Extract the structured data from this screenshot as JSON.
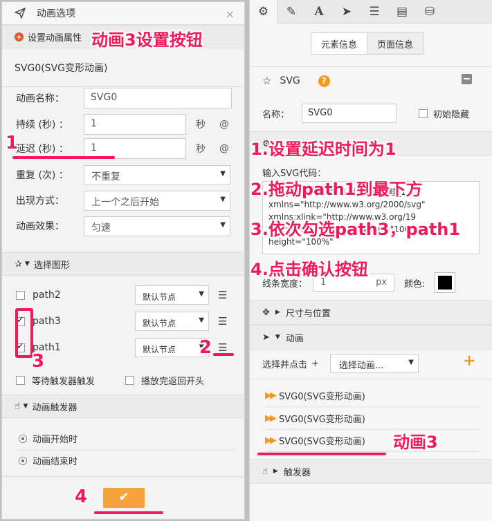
{
  "dialog": {
    "title": "动画选项",
    "close": "×",
    "section1": "设置动画属性",
    "svg_name": "SVG0(SVG变形动画)",
    "fields": {
      "name_label": "动画名称：",
      "name_value": "SVG0",
      "duration_label": "持续 (秒) ：",
      "duration_value": "1",
      "delay_label": "延迟 (秒) ：",
      "delay_value": "1",
      "unit": "秒",
      "at": "@",
      "repeat_label": "重复 (次)",
      "colon": "：",
      "repeat_value": "不重复",
      "appear_label": "出现方式：",
      "appear_value": "上一个之后开始",
      "effect_label": "动画效果：",
      "effect_value": "匀速"
    },
    "section2": "选择图形",
    "paths": [
      {
        "label": "path2",
        "checked": false,
        "node": "默认节点"
      },
      {
        "label": "path3",
        "checked": true,
        "node": "默认节点"
      },
      {
        "label": "path1",
        "checked": true,
        "node": "默认节点"
      }
    ],
    "wait_trigger": "等待触发器触发",
    "loop_back": "播放完返回开头",
    "section3": "动画触发器",
    "trigger_start": "动画开始时",
    "trigger_end": "动画结束时",
    "ok": "✔"
  },
  "panel": {
    "tabs": [
      "元素信息",
      "页面信息"
    ],
    "element_type": "SVG",
    "help": "?",
    "name_label": "名称：",
    "name_value": "SVG0",
    "initial_hidden": "初始隐藏",
    "code_label": "输入SVG代码：",
    "code_lines": [
      "<svg version=\"1.1\" id=\"铁快畦_1",
      "xmlns=\"http://www.w3.org/2000/svg\"",
      "xmlns:xlink=\"http://www.w3.org/19",
      "nk\" x=\"0px\" y=\"0px\" width=\"100%",
      "height=\"100%\""
    ],
    "stroke_label": "线条宽度：",
    "stroke_value": "1",
    "stroke_unit": "px",
    "color_label": "颜色:",
    "size_pos": "尺寸与位置",
    "animation": "动画",
    "select_click": "选择并点击",
    "select_plus": "+",
    "select_anim": "选择动画...",
    "add": "+",
    "anims": [
      "SVG0(SVG变形动画)",
      "SVG0(SVG变形动画)",
      "SVG0(SVG变形动画)"
    ],
    "triggers": "触发器"
  },
  "annotations": {
    "a_top": "动画3设置按钮",
    "s1": "1.设置延迟时间为1",
    "s2": "2.拖动path1到最下方",
    "s3": "3.依次勾选path3，path1",
    "s4": "4.点击确认按钮",
    "n1": "1",
    "n2": "2",
    "n3": "3",
    "n4": "4",
    "anim3": "动画3"
  },
  "colors": {
    "accent": "#f01a5a",
    "orange": "#f39a1f",
    "ok": "#f7a23c"
  }
}
